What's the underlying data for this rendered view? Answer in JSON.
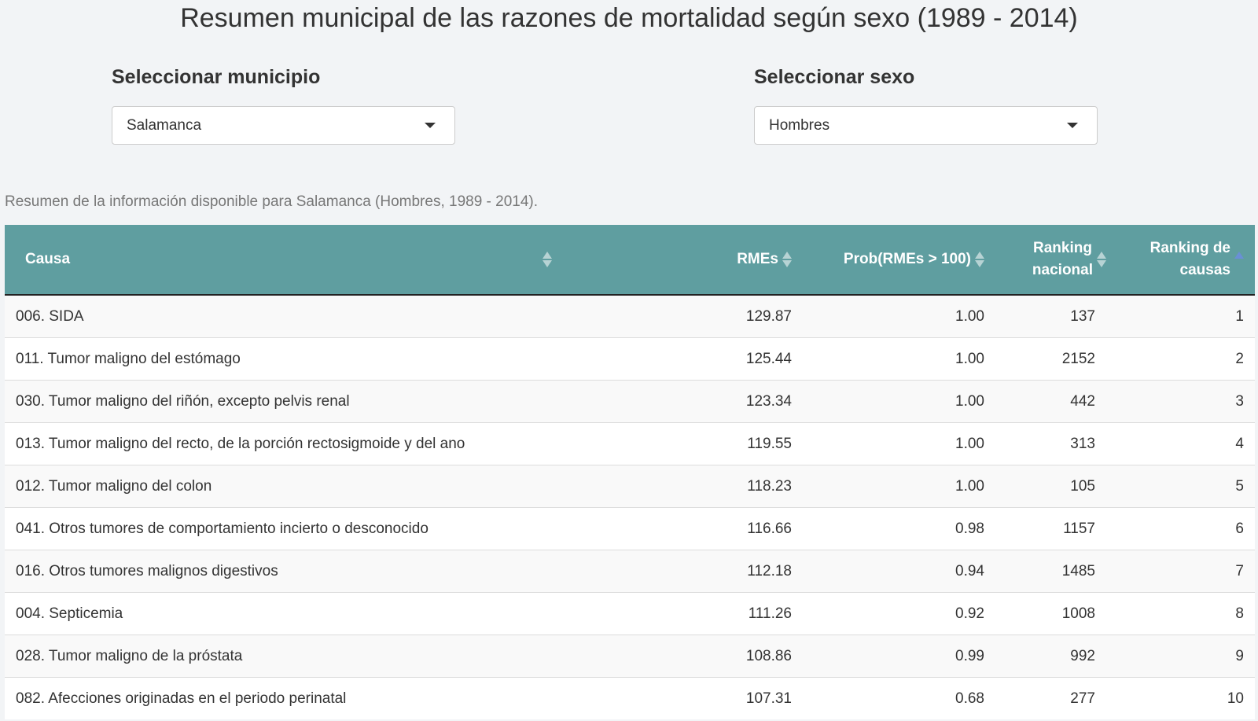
{
  "page": {
    "title": "Resumen municipal de las razones de mortalidad según sexo (1989 - 2014)"
  },
  "controls": {
    "municipio": {
      "label": "Seleccionar municipio",
      "selected": "Salamanca"
    },
    "sexo": {
      "label": "Seleccionar sexo",
      "selected": "Hombres"
    }
  },
  "table": {
    "caption": "Resumen de la información disponible para Salamanca (Hombres, 1989 - 2014).",
    "columns": {
      "causa": "Causa",
      "rmes": "RMEs",
      "prob": "Prob(RMEs > 100)",
      "ranking_nacional_1": "Ranking",
      "ranking_nacional_2": "nacional",
      "ranking_causas_1": "Ranking de",
      "ranking_causas_2": "causas"
    },
    "rows": [
      {
        "causa": "006. SIDA",
        "rmes": "129.87",
        "prob": "1.00",
        "ranking_nacional": "137",
        "ranking_causas": "1"
      },
      {
        "causa": "011. Tumor maligno del estómago",
        "rmes": "125.44",
        "prob": "1.00",
        "ranking_nacional": "2152",
        "ranking_causas": "2"
      },
      {
        "causa": "030. Tumor maligno del riñón, excepto pelvis renal",
        "rmes": "123.34",
        "prob": "1.00",
        "ranking_nacional": "442",
        "ranking_causas": "3"
      },
      {
        "causa": "013. Tumor maligno del recto, de la porción rectosigmoide y del ano",
        "rmes": "119.55",
        "prob": "1.00",
        "ranking_nacional": "313",
        "ranking_causas": "4"
      },
      {
        "causa": "012. Tumor maligno del colon",
        "rmes": "118.23",
        "prob": "1.00",
        "ranking_nacional": "105",
        "ranking_causas": "5"
      },
      {
        "causa": "041. Otros tumores de comportamiento incierto o desconocido",
        "rmes": "116.66",
        "prob": "0.98",
        "ranking_nacional": "1157",
        "ranking_causas": "6"
      },
      {
        "causa": "016. Otros tumores malignos digestivos",
        "rmes": "112.18",
        "prob": "0.94",
        "ranking_nacional": "1485",
        "ranking_causas": "7"
      },
      {
        "causa": "004. Septicemia",
        "rmes": "111.26",
        "prob": "0.92",
        "ranking_nacional": "1008",
        "ranking_causas": "8"
      },
      {
        "causa": "028. Tumor maligno de la próstata",
        "rmes": "108.86",
        "prob": "0.99",
        "ranking_nacional": "992",
        "ranking_causas": "9"
      },
      {
        "causa": "082. Afecciones originadas en el periodo perinatal",
        "rmes": "107.31",
        "prob": "0.68",
        "ranking_nacional": "277",
        "ranking_causas": "10"
      }
    ]
  },
  "colors": {
    "header_bg": "#5f9ea0",
    "page_bg": "#f2f4f6",
    "sort_active": "#6a8fd6"
  }
}
